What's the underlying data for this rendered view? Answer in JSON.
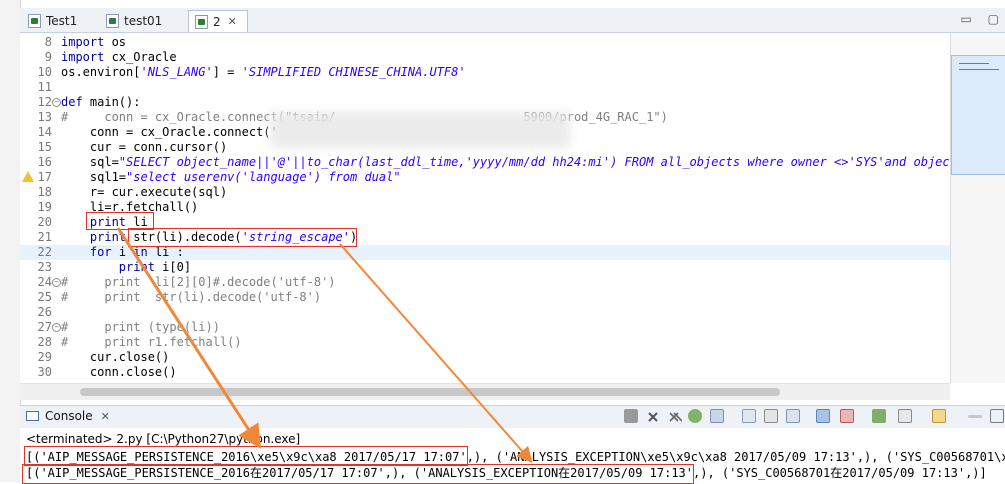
{
  "tabs": [
    {
      "label": "Test1",
      "active": false
    },
    {
      "label": "test01",
      "active": false
    },
    {
      "label": "2",
      "active": true,
      "close": "✕"
    }
  ],
  "window_controls": {
    "minimize": "▭",
    "maximize": "▢"
  },
  "editor": {
    "lines": [
      {
        "n": "8",
        "tokens": [
          {
            "t": "kw",
            "v": "import"
          },
          {
            "t": "n",
            "v": " os"
          }
        ]
      },
      {
        "n": "9",
        "tokens": [
          {
            "t": "kw",
            "v": "import"
          },
          {
            "t": "n",
            "v": " cx_Oracle"
          }
        ]
      },
      {
        "n": "10",
        "tokens": [
          {
            "t": "n",
            "v": "os.environ["
          },
          {
            "t": "str",
            "v": "'NLS_LANG'"
          },
          {
            "t": "n",
            "v": "] = "
          },
          {
            "t": "str",
            "v": "'SIMPLIFIED CHINESE_CHINA.UTF8'"
          }
        ]
      },
      {
        "n": "11",
        "tokens": []
      },
      {
        "n": "12",
        "fold": true,
        "tokens": [
          {
            "t": "kw",
            "v": "def"
          },
          {
            "t": "n",
            "v": " main():"
          }
        ]
      },
      {
        "n": "13",
        "tokens": [
          {
            "t": "cmt",
            "v": "#     conn = cx_Oracle.connect(\"tsaip/                          5900/prod_4G_RAC_1\")"
          }
        ]
      },
      {
        "n": "14",
        "tokens": [
          {
            "t": "n",
            "v": "    conn = cx_Oracle.connect('"
          }
        ]
      },
      {
        "n": "15",
        "tokens": [
          {
            "t": "n",
            "v": "    cur = conn.cursor()"
          }
        ]
      },
      {
        "n": "16",
        "tokens": [
          {
            "t": "n",
            "v": "    sql="
          },
          {
            "t": "str",
            "v": "\"SELECT object_name||'@'||to_char(last_ddl_time,'yyyy/mm/dd hh24:mi') FROM all_objects where owner <>'SYS'and object_ty"
          }
        ]
      },
      {
        "n": "17",
        "warn": true,
        "tokens": [
          {
            "t": "n",
            "v": "    sql1="
          },
          {
            "t": "str",
            "v": "\"select userenv('language') from dual\""
          }
        ]
      },
      {
        "n": "18",
        "tokens": [
          {
            "t": "n",
            "v": "    r= cur.execute(sql)"
          }
        ]
      },
      {
        "n": "19",
        "tokens": [
          {
            "t": "n",
            "v": "    li=r.fetchall()"
          }
        ]
      },
      {
        "n": "20",
        "tokens": [
          {
            "t": "n",
            "v": "    "
          },
          {
            "t": "kw",
            "v": "print"
          },
          {
            "t": "n",
            "v": " li"
          }
        ]
      },
      {
        "n": "21",
        "tokens": [
          {
            "t": "n",
            "v": "    "
          },
          {
            "t": "kw",
            "v": "print"
          },
          {
            "t": "n",
            "v": " str(li).decode("
          },
          {
            "t": "str",
            "v": "'string_escape'"
          },
          {
            "t": "n",
            "v": ")"
          }
        ]
      },
      {
        "n": "22",
        "current": true,
        "tokens": [
          {
            "t": "n",
            "v": "    "
          },
          {
            "t": "kw",
            "v": "for"
          },
          {
            "t": "n",
            "v": " i "
          },
          {
            "t": "kw",
            "v": "in"
          },
          {
            "t": "n",
            "v": " li :"
          }
        ]
      },
      {
        "n": "23",
        "tokens": [
          {
            "t": "n",
            "v": "        "
          },
          {
            "t": "kw",
            "v": "print"
          },
          {
            "t": "n",
            "v": " i[0]"
          }
        ]
      },
      {
        "n": "24",
        "fold": true,
        "tokens": [
          {
            "t": "cmt",
            "v": "#     print  li[2][0]#.decode('utf-8')"
          }
        ]
      },
      {
        "n": "25",
        "tokens": [
          {
            "t": "cmt",
            "v": "#     print  str(li).decode('utf-8')"
          }
        ]
      },
      {
        "n": "26",
        "tokens": []
      },
      {
        "n": "27",
        "fold": true,
        "tokens": [
          {
            "t": "cmt",
            "v": "#     print (type(li))"
          }
        ]
      },
      {
        "n": "28",
        "tokens": [
          {
            "t": "cmt",
            "v": "#     print r1.fetchall()"
          }
        ]
      },
      {
        "n": "29",
        "tokens": [
          {
            "t": "n",
            "v": "    cur.close()"
          }
        ]
      },
      {
        "n": "30",
        "tokens": [
          {
            "t": "n",
            "v": "    conn.close()"
          }
        ]
      }
    ]
  },
  "console": {
    "tab_label": "Console",
    "tab_close": "✕",
    "terminated": "<terminated> 2.py [C:\\Python27\\python.exe]",
    "output_line1": "[('AIP_MESSAGE_PERSISTENCE_2016\\xe5\\x9c\\xa8 2017/05/17 17:07',), ('ANALYSIS_EXCEPTION\\xe5\\x9c\\xa8 2017/05/09 17:13',), ('SYS_C00568701\\xe5\\x9",
    "output_line2": "[('AIP_MESSAGE_PERSISTENCE_2016在2017/05/17 17:07',), ('ANALYSIS_EXCEPTION在2017/05/09 17:13',), ('SYS_C00568701在2017/05/09 17:13',)]"
  },
  "colors": {
    "annotation_red": "#e0322a",
    "arrow_orange": "#f0883a",
    "keyword": "#0000a0",
    "string": "#2a00ff",
    "comment": "#808080"
  }
}
